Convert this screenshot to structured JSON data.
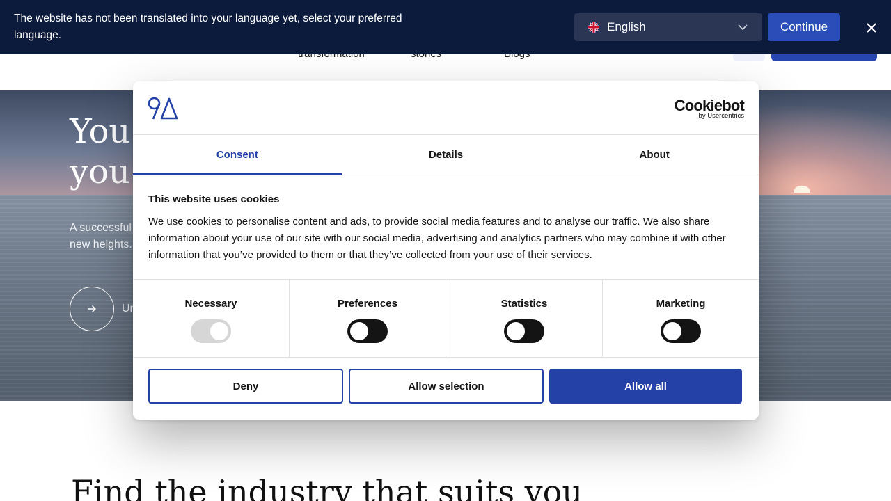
{
  "site": {
    "nav": [
      "transformation",
      "stories",
      "Blogs"
    ],
    "hero": {
      "title_lines": [
        "You",
        "you"
      ],
      "text": "A successful new heights.",
      "cta_label": "Ur"
    },
    "section_heading": "Find the industry that suits you"
  },
  "language_banner": {
    "message": "The website has not been translated into your language yet, select your preferred language.",
    "selected_language": "English",
    "continue_label": "Continue"
  },
  "cookie_dialog": {
    "provider": {
      "name": "Cookiebot",
      "sub": "by Usercentrics"
    },
    "tabs": [
      {
        "label": "Consent",
        "active": true
      },
      {
        "label": "Details",
        "active": false
      },
      {
        "label": "About",
        "active": false
      }
    ],
    "title": "This website uses cookies",
    "text": "We use cookies to personalise content and ads, to provide social media features and to analyse our traffic. We also share information about your use of our site with our social media, advertising and analytics partners who may combine it with other information that you’ve provided to them or that they’ve collected from your use of their services.",
    "categories": [
      {
        "label": "Necessary",
        "enabled": true,
        "locked": true
      },
      {
        "label": "Preferences",
        "enabled": false,
        "locked": false
      },
      {
        "label": "Statistics",
        "enabled": false,
        "locked": false
      },
      {
        "label": "Marketing",
        "enabled": false,
        "locked": false
      }
    ],
    "buttons": {
      "deny": "Deny",
      "allow_selection": "Allow selection",
      "allow_all": "Allow all"
    }
  },
  "colors": {
    "banner_bg": "#0c1a3c",
    "accent": "#2441a8",
    "toggle_off": "#141414",
    "toggle_locked": "#d6d6d6"
  },
  "icons": [
    "uk-flag-icon",
    "chevron-down-icon",
    "close-icon",
    "arrow-right-icon",
    "brand-logo",
    "cookiebot-logo"
  ]
}
